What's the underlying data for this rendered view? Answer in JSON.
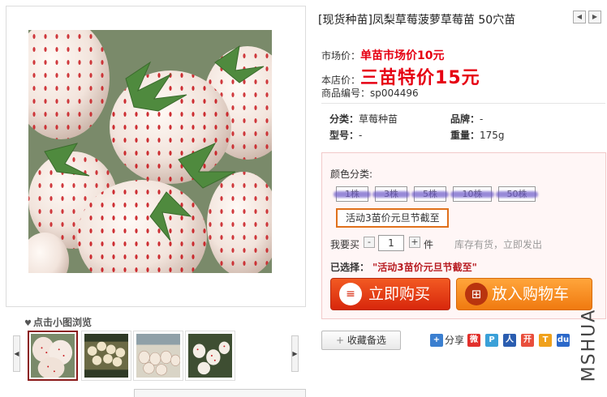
{
  "product": {
    "title": "[现货种苗]凤梨草莓菠萝草莓苗 50穴苗",
    "market_price_label": "市场价：",
    "market_price": "单苗市场价10元",
    "store_price_label": "本店价：",
    "store_price": "三苗特价15元",
    "sku_label": "商品编号：",
    "sku": "sp004496"
  },
  "attributes": {
    "category_label": "分类：",
    "category": "草莓种苗",
    "brand_label": "品牌：",
    "brand": "-",
    "model_label": "型号：",
    "model": "-",
    "weight_label": "重量：",
    "weight": "175g"
  },
  "gallery": {
    "hint": "点击小图浏览",
    "selected_index": 0
  },
  "purchase": {
    "color_label": "颜色分类:",
    "options": [
      "1株",
      "3株",
      "5株",
      "10株",
      "50株"
    ],
    "promo": "活动3苗价元旦节截至",
    "qty_label": "我要买",
    "qty": "1",
    "qty_unit": "件",
    "stock_text": "库存有货，立即发出",
    "selected_label": "已选择：",
    "selected_value": "\"活动3苗价元旦节截至\"",
    "buy_now": "立即购买",
    "add_cart": "放入购物车"
  },
  "actions": {
    "favorite": "收藏备选",
    "share": "分享"
  },
  "watermark": "MSHUA",
  "colors": {
    "price_red": "#e60012",
    "buy_orange": "#e8461a",
    "cart_orange": "#f8921f",
    "promo_border": "#e0701b"
  }
}
